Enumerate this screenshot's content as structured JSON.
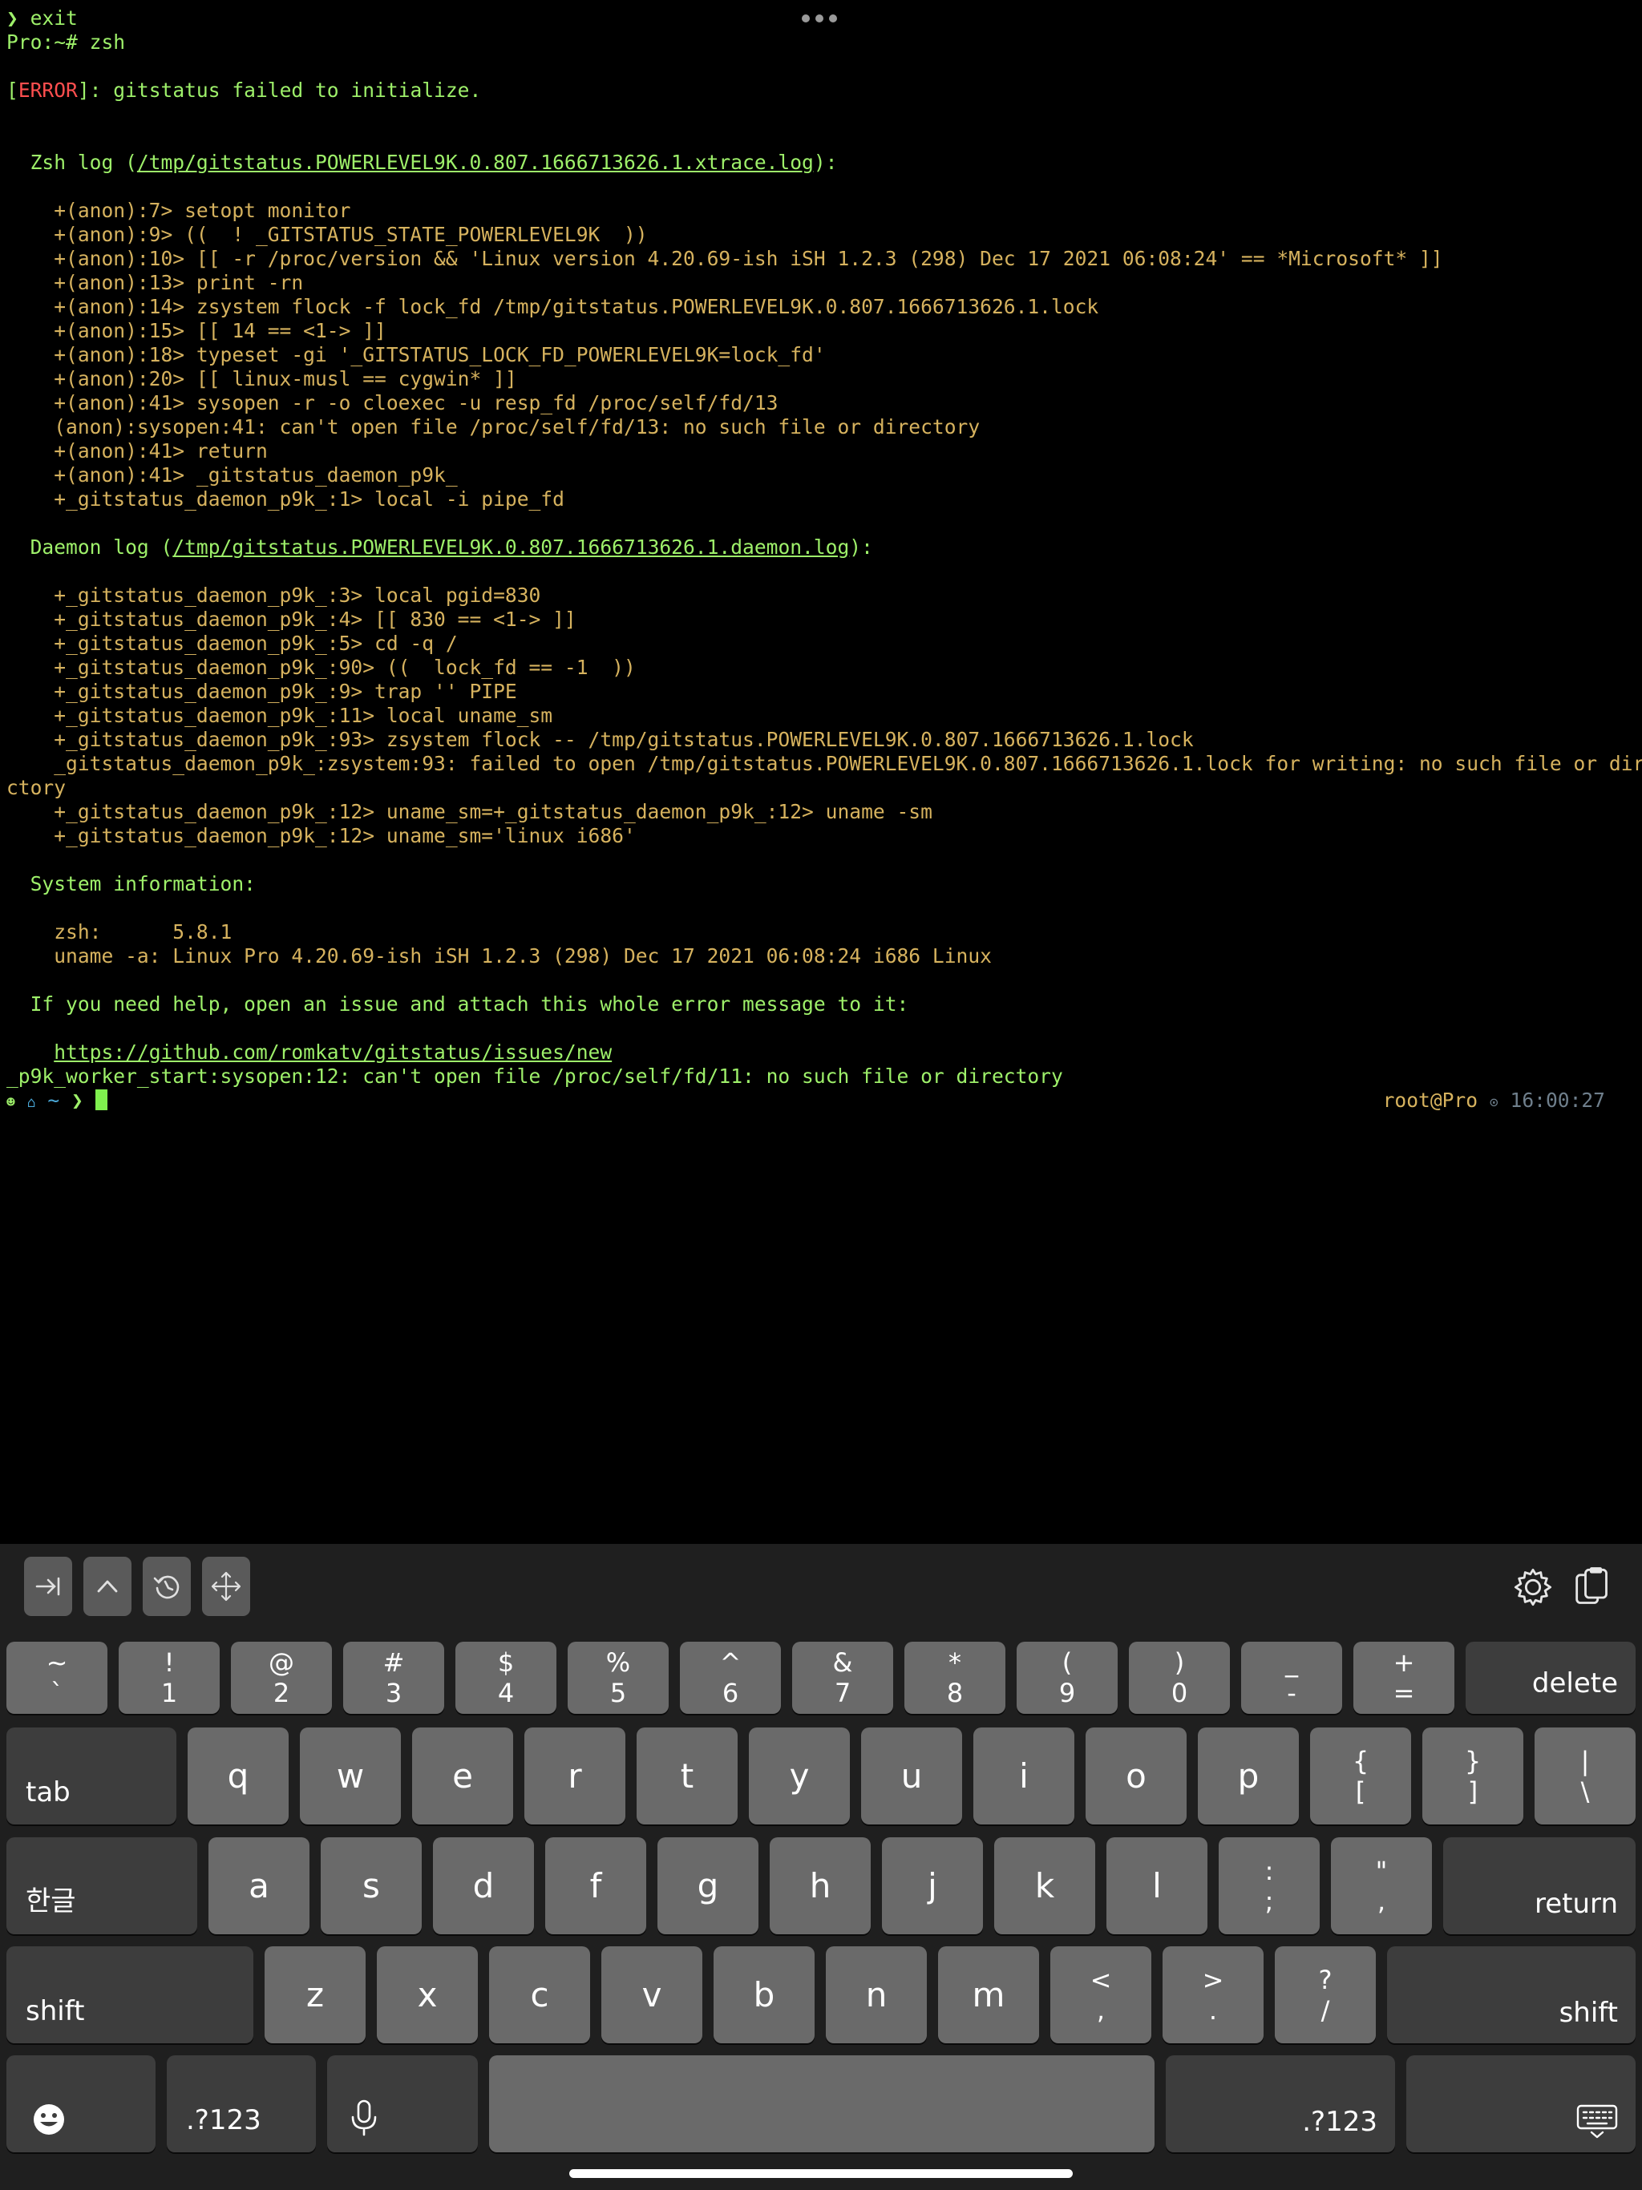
{
  "terminal": {
    "lines": {
      "l1": "❯ exit",
      "l2": "Pro:~# zsh",
      "l3_bracket_open": "[",
      "l3_error": "ERROR",
      "l3_rest": "]: gitstatus failed to initialize.",
      "l4_pre": "  Zsh log (",
      "l4_link": "/tmp/gitstatus.POWERLEVEL9K.0.807.1666713626.1.xtrace.log",
      "l4_post": "):",
      "x1": "    +(anon):7> setopt monitor",
      "x2": "    +(anon):9> ((  ! _GITSTATUS_STATE_POWERLEVEL9K  ))",
      "x3": "    +(anon):10> [[ -r /proc/version && 'Linux version 4.20.69-ish iSH 1.2.3 (298) Dec 17 2021 06:08:24' == *Microsoft* ]]",
      "x4": "    +(anon):13> print -rn",
      "x5": "    +(anon):14> zsystem flock -f lock_fd /tmp/gitstatus.POWERLEVEL9K.0.807.1666713626.1.lock",
      "x6": "    +(anon):15> [[ 14 == <1-> ]]",
      "x7": "    +(anon):18> typeset -gi '_GITSTATUS_LOCK_FD_POWERLEVEL9K=lock_fd'",
      "x8": "    +(anon):20> [[ linux-musl == cygwin* ]]",
      "x9": "    +(anon):41> sysopen -r -o cloexec -u resp_fd /proc/self/fd/13",
      "x10": "    (anon):sysopen:41: can't open file /proc/self/fd/13: no such file or directory",
      "x11": "    +(anon):41> return",
      "x12": "    +(anon):41> _gitstatus_daemon_p9k_",
      "x13": "    +_gitstatus_daemon_p9k_:1> local -i pipe_fd",
      "d_pre": "  Daemon log (",
      "d_link": "/tmp/gitstatus.POWERLEVEL9K.0.807.1666713626.1.daemon.log",
      "d_post": "):",
      "d1": "    +_gitstatus_daemon_p9k_:3> local pgid=830",
      "d2": "    +_gitstatus_daemon_p9k_:4> [[ 830 == <1-> ]]",
      "d3": "    +_gitstatus_daemon_p9k_:5> cd -q /",
      "d4": "    +_gitstatus_daemon_p9k_:90> ((  lock_fd == -1  ))",
      "d5": "    +_gitstatus_daemon_p9k_:9> trap '' PIPE",
      "d6": "    +_gitstatus_daemon_p9k_:11> local uname_sm",
      "d7": "    +_gitstatus_daemon_p9k_:93> zsystem flock -- /tmp/gitstatus.POWERLEVEL9K.0.807.1666713626.1.lock",
      "d8": "    _gitstatus_daemon_p9k_:zsystem:93: failed to open /tmp/gitstatus.POWERLEVEL9K.0.807.1666713626.1.lock for writing: no such file or dire",
      "d8b": "ctory",
      "d9": "    +_gitstatus_daemon_p9k_:12> uname_sm=+_gitstatus_daemon_p9k_:12> uname -sm",
      "d10": "    +_gitstatus_daemon_p9k_:12> uname_sm='linux i686'",
      "s_head": "  System information:",
      "s1": "    zsh:      5.8.1",
      "s2": "    uname -a: Linux Pro 4.20.69-ish iSH 1.2.3 (298) Dec 17 2021 06:08:24 i686 Linux",
      "help": "  If you need help, open an issue and attach this whole error message to it:",
      "help_pre": "    ",
      "help_link": "https://github.com/romkatv/gitstatus/issues/new",
      "worker": "_p9k_worker_start:sysopen:12: can't open file /proc/self/fd/11: no such file or directory",
      "prompt_dir": "~",
      "prompt_arrow": "❯"
    },
    "rprompt": {
      "user_host": "root@Pro",
      "time": "16:00:27"
    }
  },
  "keyboard": {
    "number_row": [
      {
        "top": "~",
        "bot": "`"
      },
      {
        "top": "!",
        "bot": "1"
      },
      {
        "top": "@",
        "bot": "2"
      },
      {
        "top": "#",
        "bot": "3"
      },
      {
        "top": "$",
        "bot": "4"
      },
      {
        "top": "%",
        "bot": "5"
      },
      {
        "top": "^",
        "bot": "6"
      },
      {
        "top": "&",
        "bot": "7"
      },
      {
        "top": "*",
        "bot": "8"
      },
      {
        "top": "(",
        "bot": "9"
      },
      {
        "top": ")",
        "bot": "0"
      },
      {
        "top": "_",
        "bot": "-"
      },
      {
        "top": "+",
        "bot": "="
      }
    ],
    "delete": "delete",
    "tab": "tab",
    "row_q": [
      "q",
      "w",
      "e",
      "r",
      "t",
      "y",
      "u",
      "i",
      "o",
      "p"
    ],
    "bracket_open": {
      "top": "{",
      "bot": "["
    },
    "bracket_close": {
      "top": "}",
      "bot": "]"
    },
    "pipe": {
      "top": "|",
      "bot": "\\"
    },
    "lang": "한글",
    "row_a": [
      "a",
      "s",
      "d",
      "f",
      "g",
      "h",
      "j",
      "k",
      "l"
    ],
    "colon": {
      "top": ":",
      "bot": ";"
    },
    "quote": {
      "top": "\"",
      "bot": ","
    },
    "return": "return",
    "shift": "shift",
    "row_z": [
      "z",
      "x",
      "c",
      "v",
      "b",
      "n",
      "m"
    ],
    "lt": {
      "top": "<",
      "bot": ","
    },
    "gt": {
      "top": ">",
      "bot": "."
    },
    "question": {
      "top": "?",
      "bot": "/"
    },
    "numbers_key": ".?123"
  }
}
